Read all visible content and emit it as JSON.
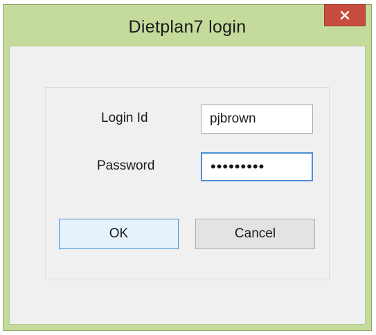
{
  "window": {
    "title": "Dietplan7 login",
    "close_label": "×"
  },
  "form": {
    "login_id_label": "Login Id",
    "login_id_value": "pjbrown",
    "password_label": "Password",
    "password_value": "pjbrown12"
  },
  "buttons": {
    "ok_label": "OK",
    "cancel_label": "Cancel"
  },
  "colors": {
    "frame": "#c5db9c",
    "close_button": "#c74d3f",
    "focus_border": "#4a8fd6",
    "client_background": "#f0f0f0"
  }
}
